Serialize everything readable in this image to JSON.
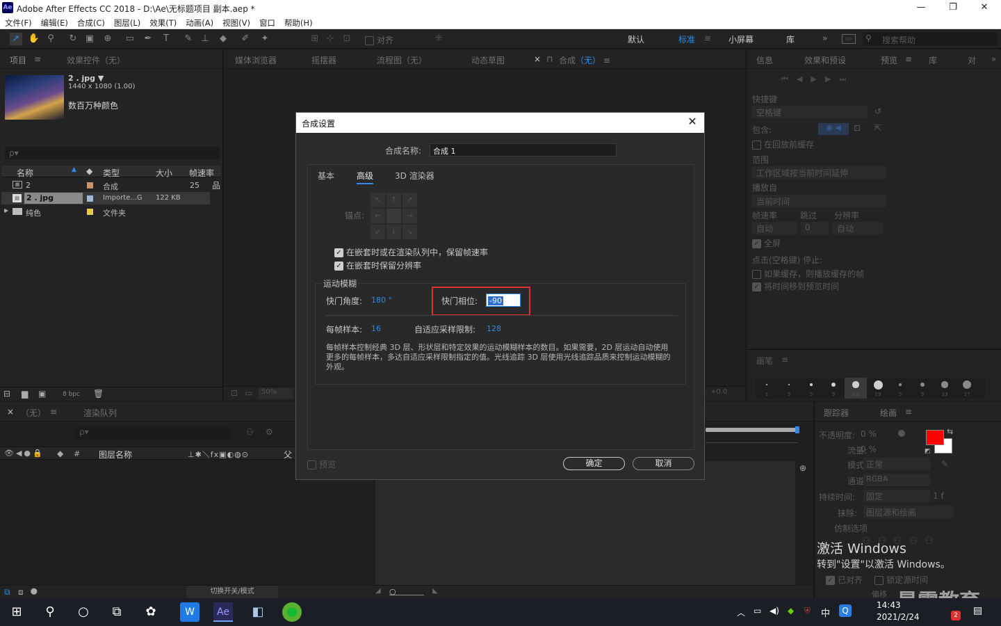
{
  "window": {
    "app_logo": "Ae",
    "title": "Adobe After Effects CC 2018 - D:\\Ae\\无标题项目 副本.aep *",
    "controls": [
      "—",
      "❐",
      "✕"
    ]
  },
  "menu": [
    "文件(F)",
    "编辑(E)",
    "合成(C)",
    "图层(L)",
    "效果(T)",
    "动画(A)",
    "视图(V)",
    "窗口",
    "帮助(H)"
  ],
  "toolbar": {
    "align_label": "对齐",
    "workspaces": [
      "默认",
      "标准",
      "小屏幕",
      "库"
    ],
    "active_workspace": "标准",
    "more": "»",
    "search_placeholder": "搜索帮助"
  },
  "project_panel": {
    "tab_project": "项目",
    "tab_effects": "效果控件（无）",
    "asset_name": "2 . jpg ▼",
    "asset_dims": "1440 x 1080 (1.00)",
    "asset_color": "数百万种颜色",
    "search_placeholder": "ρ▾",
    "columns": [
      "名称",
      "类型",
      "大小",
      "帧速率"
    ],
    "rows": [
      {
        "name": "2",
        "type": "合成",
        "size": "",
        "fps": "25",
        "swatch": "#c8926a"
      },
      {
        "name": "2 . jpg",
        "type": "Importe...G",
        "size": "122 KB",
        "fps": "",
        "swatch": "#9fb7d4"
      },
      {
        "name": "纯色",
        "type": "文件夹",
        "size": "",
        "fps": "",
        "swatch": "#e5c94a"
      }
    ],
    "bpc": "8 bpc"
  },
  "viewer": {
    "tabs": [
      "媒体浏览器",
      "摇摆器",
      "流程图（无）",
      "动态草图"
    ],
    "comp_tab_prefix": "合成",
    "comp_tab_name": "（无）",
    "zoom": "50%",
    "exposure": "+0.0"
  },
  "right_panel": {
    "tabs": [
      "信息",
      "效果和预设",
      "预览",
      "库",
      "对"
    ],
    "shortcut_label": "快捷键",
    "shortcut_value": "空格键",
    "include_label": "包含:",
    "cache_before_play": "在回放前缓存",
    "range_label": "范围",
    "range_value": "工作区域按当前时间延伸",
    "play_from_label": "播放自",
    "play_from_value": "当前时间",
    "fps_label": "帧速率",
    "skip_label": "跳过",
    "res_label": "分辨率",
    "fps_value": "自动",
    "skip_value": "0",
    "res_value": "自动",
    "fullscreen": "全屏",
    "stop_label": "点击(空格键) 停止:",
    "stop_opt1": "如果缓存，则播放缓存的帧",
    "stop_opt2": "将时间移到预览时间",
    "brush_tab": "画笔",
    "brush_sizes": [
      "1",
      "3",
      "5",
      "9",
      "13",
      "19",
      "5",
      "9",
      "13",
      "17"
    ]
  },
  "timeline": {
    "tab_none": "（无）",
    "tab_render": "渲染队列",
    "layer_name_header": "图层名称",
    "parent_header": "父",
    "toggle_label": "切换开关/模式"
  },
  "paint_panel": {
    "tab_tracker": "跟踪器",
    "tab_paint": "绘画",
    "opacity_label": "不透明度:",
    "opacity_value": "0 %",
    "flow_label": "流量:",
    "flow_value": "0 %",
    "mode_label": "模式:",
    "mode_value": "正常",
    "channel_label": "通道:",
    "channel_value": "RGBA",
    "duration_label": "持续时间:",
    "duration_value": "固定",
    "duration_frames": "1 f",
    "erase_label": "抹除:",
    "erase_value": "图层源和绘画",
    "clone_label": "仿制选项",
    "aligned_label": "已对齐",
    "lock_time_label": "锁定源时间",
    "offset_label": "偏移",
    "fg_color": "#ff0000",
    "bg_color": "#ffffff"
  },
  "dialog": {
    "title": "合成设置",
    "name_label": "合成名称:",
    "name_value": "合成 1",
    "tabs": [
      "基本",
      "高级",
      "3D 渲染器"
    ],
    "active_tab": "高级",
    "anchor_label": "锚点:",
    "keep_fps": "在嵌套时或在渲染队列中，保留帧速率",
    "keep_res": "在嵌套时保留分辨率",
    "motion_blur_title": "运动模糊",
    "shutter_angle_label": "快门角度:",
    "shutter_angle_value": "180 °",
    "shutter_phase_label": "快门相位:",
    "shutter_phase_value": "-90",
    "samples_label": "每帧样本:",
    "samples_value": "16",
    "adaptive_label": "自适应采样限制:",
    "adaptive_value": "128",
    "description": "每帧样本控制经典 3D 层、形状层和特定效果的运动模糊样本的数目。如果需要，2D 层运动自动使用更多的每帧样本，多达自适应采样限制指定的值。光线追踪 3D 层使用光线追踪品质来控制运动模糊的外观。",
    "preview_label": "预览",
    "ok_label": "确定",
    "cancel_label": "取消",
    "highlight_color": "#e03030"
  },
  "watermark": {
    "line1": "激活 Windows",
    "line2": "转到\"设置\"以激活 Windows。",
    "brand": "最需教育"
  },
  "taskbar": {
    "time": "14:43",
    "date": "2021/2/24",
    "ime": "中",
    "notifications": "2"
  }
}
